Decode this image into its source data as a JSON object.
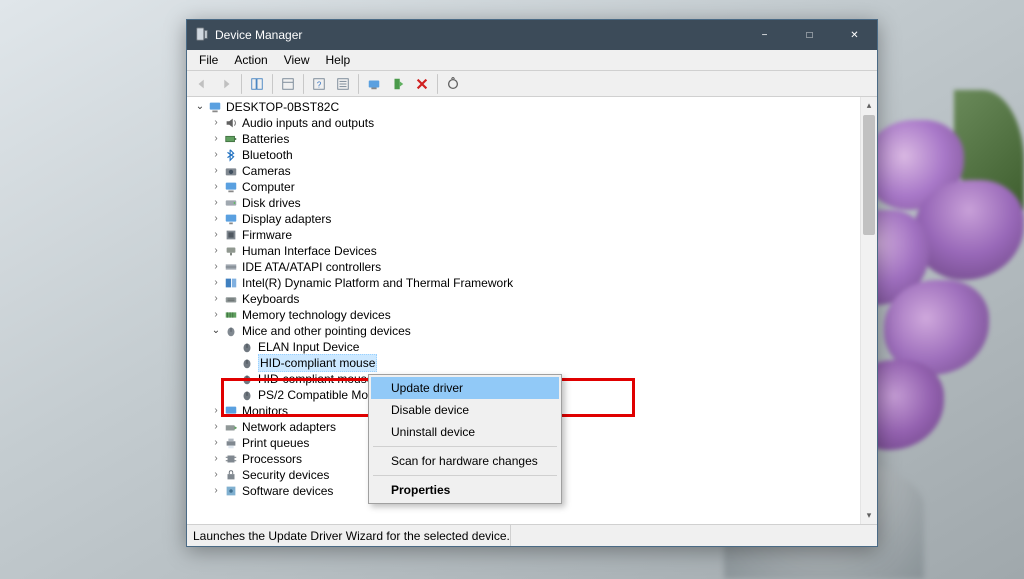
{
  "window": {
    "title": "Device Manager"
  },
  "menubar": {
    "items": [
      "File",
      "Action",
      "View",
      "Help"
    ]
  },
  "tree": {
    "root": "DESKTOP-0BST82C",
    "categories": [
      {
        "label": "Audio inputs and outputs",
        "expanded": false
      },
      {
        "label": "Batteries",
        "expanded": false
      },
      {
        "label": "Bluetooth",
        "expanded": false
      },
      {
        "label": "Cameras",
        "expanded": false
      },
      {
        "label": "Computer",
        "expanded": false
      },
      {
        "label": "Disk drives",
        "expanded": false
      },
      {
        "label": "Display adapters",
        "expanded": false
      },
      {
        "label": "Firmware",
        "expanded": false
      },
      {
        "label": "Human Interface Devices",
        "expanded": false
      },
      {
        "label": "IDE ATA/ATAPI controllers",
        "expanded": false
      },
      {
        "label": "Intel(R) Dynamic Platform and Thermal Framework",
        "expanded": false
      },
      {
        "label": "Keyboards",
        "expanded": false
      },
      {
        "label": "Memory technology devices",
        "expanded": false
      },
      {
        "label": "Mice and other pointing devices",
        "expanded": true,
        "children": [
          "ELAN Input Device",
          "HID-compliant mouse",
          "HID-compliant mouse",
          "PS/2 Compatible Mouse"
        ]
      },
      {
        "label": "Monitors",
        "expanded": false
      },
      {
        "label": "Network adapters",
        "expanded": false
      },
      {
        "label": "Print queues",
        "expanded": false
      },
      {
        "label": "Processors",
        "expanded": false
      },
      {
        "label": "Security devices",
        "expanded": false
      },
      {
        "label": "Software devices",
        "expanded": false
      }
    ],
    "selected_child_index": 1
  },
  "context_menu": {
    "items": [
      {
        "label": "Update driver",
        "hover": true
      },
      {
        "label": "Disable device"
      },
      {
        "label": "Uninstall device"
      },
      {
        "sep": true
      },
      {
        "label": "Scan for hardware changes"
      },
      {
        "sep": true
      },
      {
        "label": "Properties",
        "bold": true
      }
    ]
  },
  "statusbar": {
    "text": "Launches the Update Driver Wizard for the selected device."
  },
  "colors": {
    "titlebar_bg": "#3c4b59",
    "context_hover": "#91c9f7",
    "highlight_border": "#e00000"
  }
}
